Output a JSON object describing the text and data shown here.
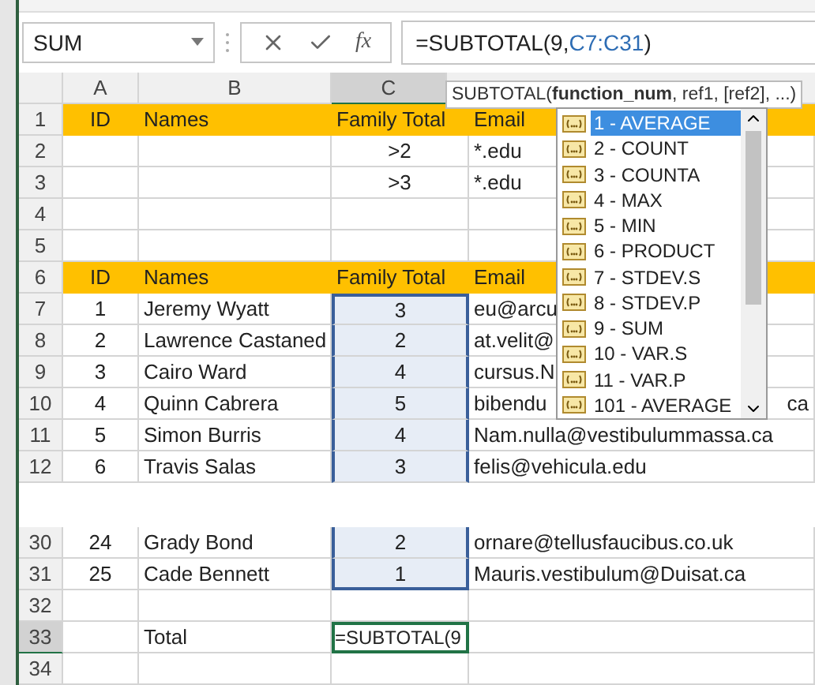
{
  "formula_bar": {
    "name_box": "SUM",
    "function_button": "fx",
    "formula": [
      {
        "text": "=SUBTOTAL(9,",
        "ref": false
      },
      {
        "text": "C7:C31",
        "ref": true
      },
      {
        "text": ")",
        "ref": false
      }
    ]
  },
  "column_headers": [
    {
      "label": "A",
      "selected": false
    },
    {
      "label": "B",
      "selected": false
    },
    {
      "label": "C",
      "selected": true
    }
  ],
  "rows": [
    {
      "kind": "row",
      "number": "1",
      "selected": false,
      "band": true,
      "cells": [
        "ID",
        "Names",
        "Family Total",
        "Email"
      ],
      "in_range": false,
      "editing": false
    },
    {
      "kind": "row",
      "number": "2",
      "selected": false,
      "band": false,
      "cells": [
        "",
        "",
        ">2",
        "*.edu"
      ],
      "in_range": false,
      "editing": false
    },
    {
      "kind": "row",
      "number": "3",
      "selected": false,
      "band": false,
      "cells": [
        "",
        "",
        ">3",
        "*.edu"
      ],
      "in_range": false,
      "editing": false
    },
    {
      "kind": "row",
      "number": "4",
      "selected": false,
      "band": false,
      "cells": [
        "",
        "",
        "",
        ""
      ],
      "in_range": false,
      "editing": false
    },
    {
      "kind": "row",
      "number": "5",
      "selected": false,
      "band": false,
      "cells": [
        "",
        "",
        "",
        ""
      ],
      "in_range": false,
      "editing": false
    },
    {
      "kind": "row",
      "number": "6",
      "selected": false,
      "band": true,
      "cells": [
        "ID",
        "Names",
        "Family Total",
        "Email"
      ],
      "in_range": false,
      "editing": false
    },
    {
      "kind": "row",
      "number": "7",
      "selected": false,
      "band": false,
      "cells": [
        "1",
        "Jeremy Wyatt",
        "3",
        "eu@arcu"
      ],
      "in_range": true,
      "editing": false
    },
    {
      "kind": "row",
      "number": "8",
      "selected": false,
      "band": false,
      "cells": [
        "2",
        "Lawrence Castaned",
        "2",
        "at.velit@"
      ],
      "in_range": true,
      "editing": false
    },
    {
      "kind": "row",
      "number": "9",
      "selected": false,
      "band": false,
      "cells": [
        "3",
        "Cairo Ward",
        "4",
        "cursus.N"
      ],
      "in_range": true,
      "editing": false
    },
    {
      "kind": "row",
      "number": "10",
      "selected": false,
      "band": false,
      "cells": [
        "4",
        "Quinn Cabrera",
        "5",
        "bibendu"
      ],
      "tail": "ca",
      "in_range": true,
      "editing": false
    },
    {
      "kind": "row",
      "number": "11",
      "selected": false,
      "band": false,
      "cells": [
        "5",
        "Simon Burris",
        "4",
        "Nam.nulla@vestibulummassa.ca"
      ],
      "in_range": true,
      "editing": false
    },
    {
      "kind": "row",
      "number": "12",
      "selected": false,
      "band": false,
      "cells": [
        "6",
        "Travis Salas",
        "3",
        "felis@vehicula.edu"
      ],
      "in_range": true,
      "editing": false
    },
    {
      "kind": "break"
    },
    {
      "kind": "row",
      "number": "30",
      "selected": false,
      "band": false,
      "cells": [
        "24",
        "Grady Bond",
        "2",
        "ornare@tellusfaucibus.co.uk"
      ],
      "in_range": true,
      "editing": false
    },
    {
      "kind": "row",
      "number": "31",
      "selected": false,
      "band": false,
      "cells": [
        "25",
        "Cade Bennett",
        "1",
        "Mauris.vestibulum@Duisat.ca"
      ],
      "in_range": true,
      "editing": false
    },
    {
      "kind": "row",
      "number": "32",
      "selected": false,
      "band": false,
      "cells": [
        "",
        "",
        "",
        ""
      ],
      "in_range": false,
      "editing": false
    },
    {
      "kind": "row",
      "number": "33",
      "selected": true,
      "band": false,
      "cells": [
        "",
        "Total",
        "=SUBTOTAL(9",
        ""
      ],
      "in_range": false,
      "editing": true
    },
    {
      "kind": "row",
      "number": "34",
      "selected": false,
      "band": false,
      "cells": [
        "",
        "",
        "",
        ""
      ],
      "in_range": false,
      "editing": false
    }
  ],
  "tooltip": "SUBTOTAL(**function_num**, ref1, [ref2], ...)",
  "autocomplete": [
    {
      "label": "1 - AVERAGE",
      "selected": true
    },
    {
      "label": "2 - COUNT",
      "selected": false
    },
    {
      "label": "3 - COUNTA",
      "selected": false
    },
    {
      "label": "4 - MAX",
      "selected": false
    },
    {
      "label": "5 - MIN",
      "selected": false
    },
    {
      "label": "6 - PRODUCT",
      "selected": false
    },
    {
      "label": "7 - STDEV.S",
      "selected": false
    },
    {
      "label": "8 - STDEV.P",
      "selected": false
    },
    {
      "label": "9 - SUM",
      "selected": false
    },
    {
      "label": "10 - VAR.S",
      "selected": false
    },
    {
      "label": "11 - VAR.P",
      "selected": false
    },
    {
      "label": "101 - AVERAGE",
      "selected": false
    }
  ]
}
